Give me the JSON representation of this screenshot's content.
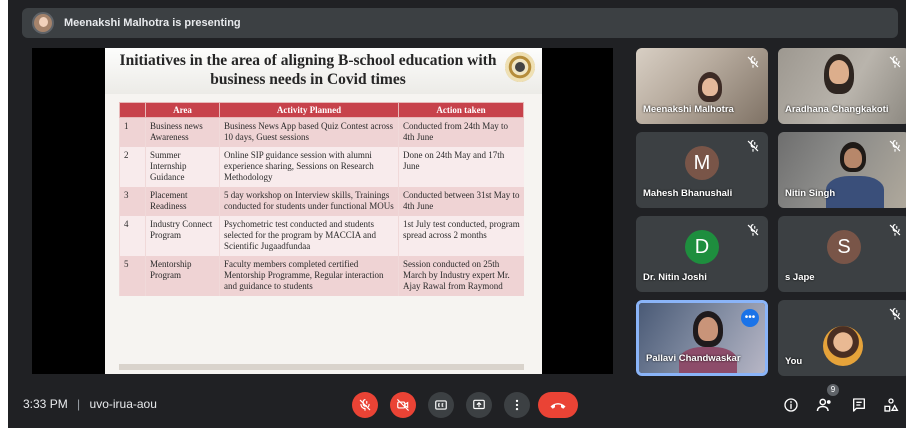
{
  "presenting": {
    "text": "Meenakshi Malhotra is presenting"
  },
  "slide": {
    "title": "Initiatives in the area of aligning B-school education with business needs in Covid times",
    "columns": [
      "",
      "Area",
      "Activity Planned",
      "Action taken"
    ],
    "rows": [
      {
        "num": "1",
        "area": "Business news Awareness",
        "plan": "Business News App based Quiz Contest across 10 days, Guest sessions",
        "action": "Conducted from 24th May to 4th June"
      },
      {
        "num": "2",
        "area": "Summer Internship Guidance",
        "plan": "Online SIP guidance session with alumni experience sharing, Sessions on Research Methodology",
        "action": "Done on 24th May and 17th June"
      },
      {
        "num": "3",
        "area": "Placement Readiness",
        "plan": "5 day workshop on Interview skills, Trainings conducted for students under functional MOUs",
        "action": "Conducted between 31st May to 4th June"
      },
      {
        "num": "4",
        "area": "Industry Connect Program",
        "plan": "Psychometric test conducted and students selected for the program by MACCIA and Scientific Jugaadfundaa",
        "action": "1st July test conducted, program spread across 2 months"
      },
      {
        "num": "5",
        "area": "Mentorship Program",
        "plan": "Faculty members completed certified Mentorship Programme, Regular interaction and guidance to students",
        "action": "Session conducted on 25th March by Industry expert Mr. Ajay Rawal from Raymond"
      }
    ]
  },
  "participants": [
    {
      "name": "Meenakshi Malhotra"
    },
    {
      "name": "Aradhana Changkakoti"
    },
    {
      "name": "Mahesh Bhanushali",
      "initial": "M",
      "color": "#795548"
    },
    {
      "name": "Nitin Singh"
    },
    {
      "name": "Dr. Nitin Joshi",
      "initial": "D",
      "color": "#1e8e3e"
    },
    {
      "name": "s Jape",
      "initial": "S",
      "color": "#795548"
    },
    {
      "name": "Pallavi Chandwaskar"
    },
    {
      "name": "You"
    }
  ],
  "bottom": {
    "time": "3:33 PM",
    "meeting_code": "uvo-irua-aou",
    "people_count": "9"
  },
  "colors": {
    "accent_red": "#ea4335",
    "table_header": "#c7424b",
    "tile_bg": "#3c4043",
    "meet_bg": "#202124"
  }
}
